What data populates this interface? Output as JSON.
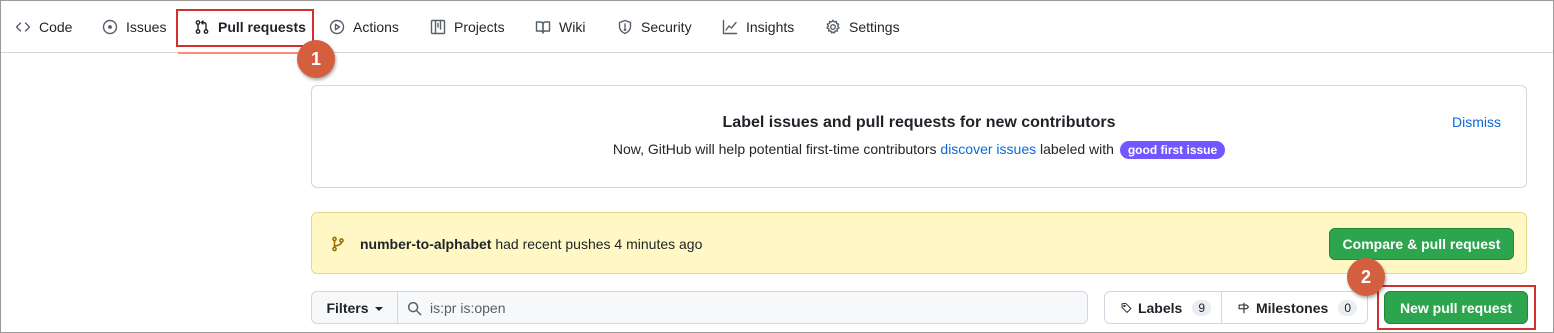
{
  "nav": {
    "tabs": [
      {
        "label": "Code",
        "icon": "code-icon"
      },
      {
        "label": "Issues",
        "icon": "issue-icon"
      },
      {
        "label": "Pull requests",
        "icon": "pull-request-icon",
        "active": true
      },
      {
        "label": "Actions",
        "icon": "play-icon"
      },
      {
        "label": "Projects",
        "icon": "table-icon"
      },
      {
        "label": "Wiki",
        "icon": "book-icon"
      },
      {
        "label": "Security",
        "icon": "shield-icon"
      },
      {
        "label": "Insights",
        "icon": "graph-icon"
      },
      {
        "label": "Settings",
        "icon": "gear-icon"
      }
    ]
  },
  "steps": {
    "one": "1",
    "two": "2"
  },
  "contributors": {
    "title": "Label issues and pull requests for new contributors",
    "text_before": "Now, GitHub will help potential first-time contributors ",
    "link": "discover issues",
    "text_after": " labeled with ",
    "label": "good first issue",
    "dismiss": "Dismiss"
  },
  "recent_push": {
    "branch": "number-to-alphabet",
    "message": " had recent pushes 4 minutes ago",
    "button": "Compare & pull request"
  },
  "filter_bar": {
    "filters_label": "Filters",
    "search_value": "is:pr is:open",
    "labels_label": "Labels",
    "labels_count": "9",
    "milestones_label": "Milestones",
    "milestones_count": "0",
    "new_pr_button": "New pull request"
  },
  "colors": {
    "accent_green": "#2da44e",
    "link_blue": "#0969da",
    "annotation_red": "#d32f2f",
    "label_purple": "#7057ff"
  }
}
